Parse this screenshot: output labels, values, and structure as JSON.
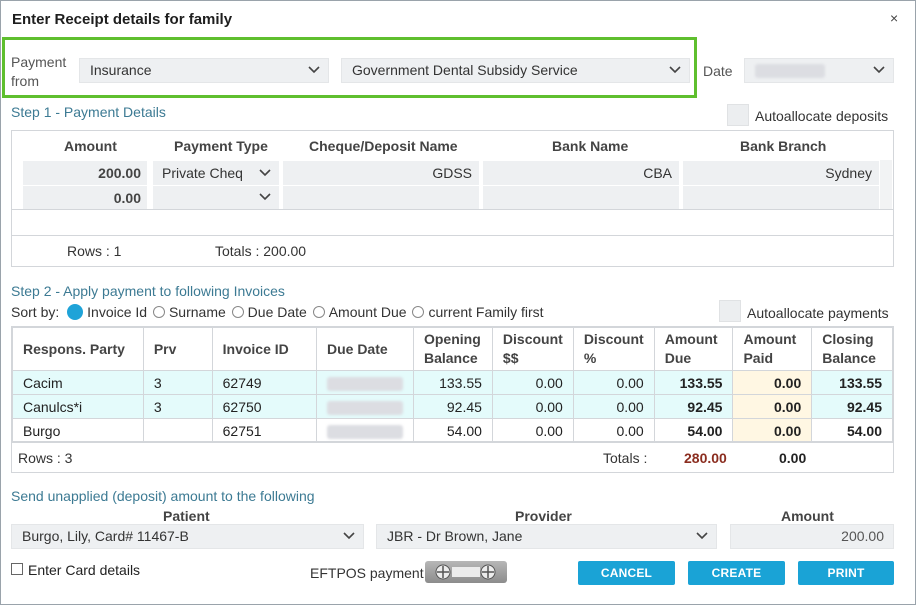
{
  "dialog": {
    "title": "Enter Receipt details for family",
    "close_glyph": "×"
  },
  "payment_from": {
    "label_line1": "Payment",
    "label_line2": "from",
    "type": "Insurance",
    "source": "Government Dental Subsidy Service",
    "date_label": "Date"
  },
  "step1": {
    "title": "Step 1 - Payment Details",
    "autoallocate_label": "Autoallocate deposits",
    "headers": [
      "Amount",
      "Payment Type",
      "Cheque/Deposit Name",
      "Bank Name",
      "Bank Branch"
    ],
    "rows": [
      {
        "amount": "200.00",
        "type": "Private Cheq",
        "name": "GDSS",
        "bank": "CBA",
        "branch": "Sydney"
      },
      {
        "amount": "0.00",
        "type": "",
        "name": "",
        "bank": "",
        "branch": ""
      }
    ],
    "rows_label": "Rows : 1",
    "totals_label": "Totals : 200.00"
  },
  "step2": {
    "title": "Step 2 - Apply payment to following Invoices",
    "sort_label": "Sort by:",
    "sort_options": [
      "Invoice Id",
      "Surname",
      "Due Date",
      "Amount Due",
      "current Family first"
    ],
    "autoallocate_label": "Autoallocate payments",
    "headers": {
      "party": "Respons. Party",
      "prv": "Prv",
      "invoice": "Invoice ID",
      "due_date": "Due Date",
      "opening_1": "Opening",
      "opening_2": "Balance",
      "discount_amt_1": "Discount",
      "discount_amt_2": "$$",
      "discount_pct_1": "Discount",
      "discount_pct_2": "%",
      "amount_due_1": "Amount",
      "amount_due_2": "Due",
      "amount_paid_1": "Amount",
      "amount_paid_2": "Paid",
      "closing_1": "Closing",
      "closing_2": "Balance"
    },
    "rows": [
      {
        "party": "Cacim",
        "prv": "3",
        "invoice": "62749",
        "opening": "133.55",
        "disc": "0.00",
        "pct": "0.00",
        "due": "133.55",
        "paid": "0.00",
        "closing": "133.55"
      },
      {
        "party": "Canulcs*i",
        "prv": "3",
        "invoice": "62750",
        "opening": "92.45",
        "disc": "0.00",
        "pct": "0.00",
        "due": "92.45",
        "paid": "0.00",
        "closing": "92.45"
      },
      {
        "party": "Burgo",
        "prv": "",
        "invoice": "62751",
        "opening": "54.00",
        "disc": "0.00",
        "pct": "0.00",
        "due": "54.00",
        "paid": "0.00",
        "closing": "54.00"
      }
    ],
    "rows_label": "Rows : 3",
    "totals_label": "Totals :",
    "total_due": "280.00",
    "total_paid": "0.00"
  },
  "deposit": {
    "title": "Send unapplied (deposit) amount to the following",
    "patient_label": "Patient",
    "provider_label": "Provider",
    "amount_label": "Amount",
    "patient": "Burgo, Lily, Card# 11467-B",
    "provider": "JBR - Dr Brown, Jane",
    "amount": "200.00"
  },
  "footer": {
    "card_details_label": "Enter Card details",
    "eftpos_label": "EFTPOS payment",
    "cancel": "CANCEL",
    "create": "CREATE",
    "print": "PRINT"
  },
  "colors": {
    "accent": "#1aa3d6",
    "highlight_border": "#5fbf2e",
    "section_text": "#3c7a93",
    "amount_due_text": "#8b2d1f",
    "closing_text": "#e02020",
    "row_highlight": "#e4fbfb",
    "paid_cell": "#fff7e3"
  }
}
